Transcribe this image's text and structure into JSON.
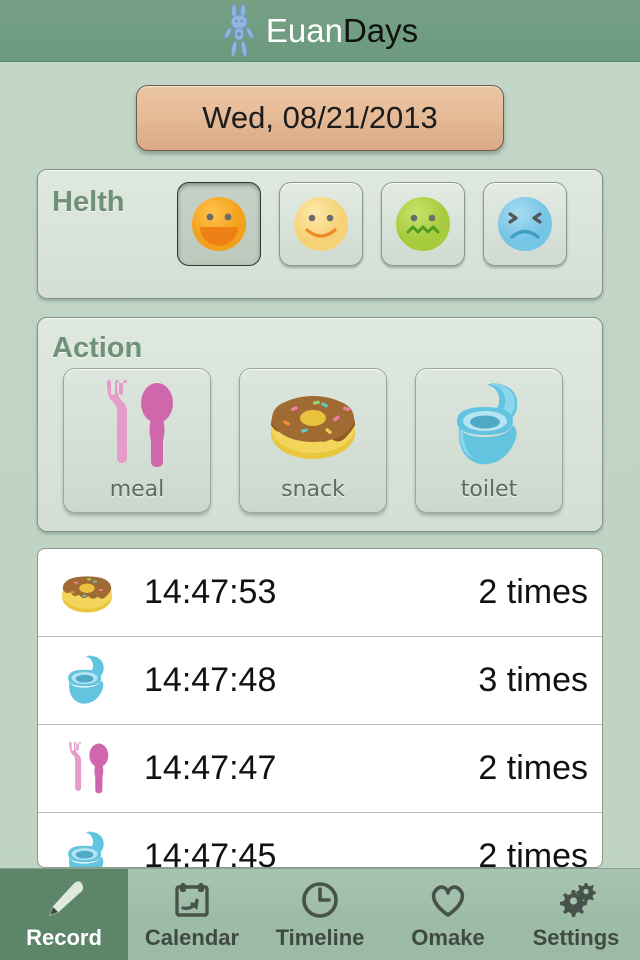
{
  "header": {
    "icon": "bunny-icon",
    "name": "Euan",
    "suffix": "Days"
  },
  "date_button": {
    "label": "Wed, 08/21/2013"
  },
  "health_section": {
    "title": "Helth",
    "options": [
      {
        "name": "happy-face",
        "state": "selected"
      },
      {
        "name": "smile-face",
        "state": "normal"
      },
      {
        "name": "sick-face",
        "state": "normal"
      },
      {
        "name": "sad-face",
        "state": "normal"
      }
    ]
  },
  "action_section": {
    "title": "Action",
    "buttons": [
      {
        "name": "meal-icon",
        "label": "meal"
      },
      {
        "name": "snack-icon",
        "label": "snack"
      },
      {
        "name": "toilet-icon",
        "label": "toilet"
      }
    ]
  },
  "records": [
    {
      "icon": "snack-icon",
      "time": "14:47:53",
      "count": "2 times"
    },
    {
      "icon": "toilet-icon",
      "time": "14:47:48",
      "count": "3 times"
    },
    {
      "icon": "meal-icon",
      "time": "14:47:47",
      "count": "2 times"
    },
    {
      "icon": "toilet-icon",
      "time": "14:47:45",
      "count": "2 times"
    }
  ],
  "tabbar": {
    "tabs": [
      {
        "label": "Record",
        "icon": "pencil-icon",
        "active": true
      },
      {
        "label": "Calendar",
        "icon": "calendar-icon",
        "active": false
      },
      {
        "label": "Timeline",
        "icon": "clock-icon",
        "active": false
      },
      {
        "label": "Omake",
        "icon": "heart-icon",
        "active": false
      },
      {
        "label": "Settings",
        "icon": "gears-icon",
        "active": false
      }
    ]
  },
  "colors": {
    "header_green": "#6f9a80",
    "background": "#bed3c4",
    "date_tan": "#e6bb97",
    "panel_title_green": "#6f9177",
    "tab_active": "#5d8569"
  }
}
